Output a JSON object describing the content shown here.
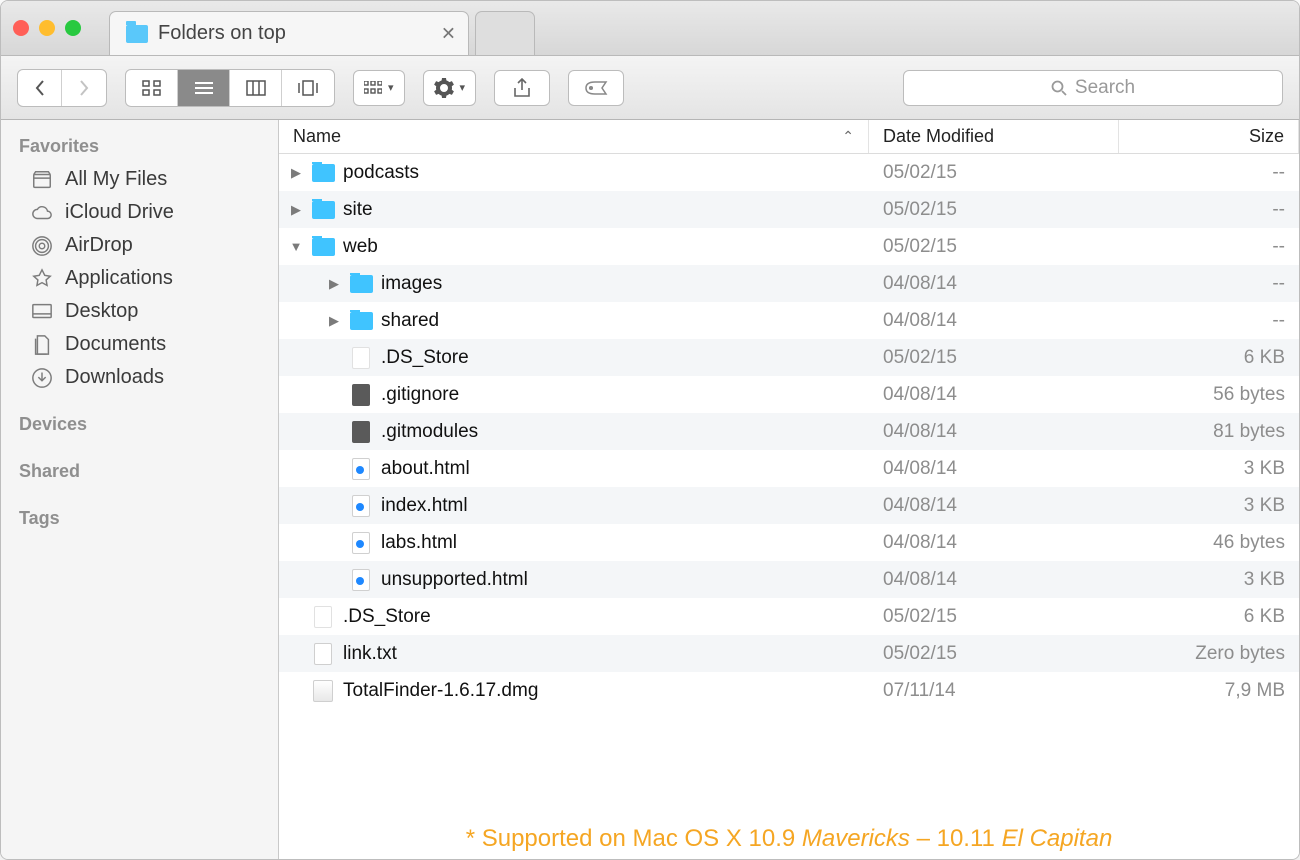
{
  "tab": {
    "title": "Folders on top"
  },
  "search": {
    "placeholder": "Search"
  },
  "sidebar": {
    "sections": [
      {
        "title": "Favorites",
        "items": [
          {
            "label": "All My Files",
            "icon": "all-my-files-icon"
          },
          {
            "label": "iCloud Drive",
            "icon": "icloud-icon"
          },
          {
            "label": "AirDrop",
            "icon": "airdrop-icon"
          },
          {
            "label": "Applications",
            "icon": "applications-icon"
          },
          {
            "label": "Desktop",
            "icon": "desktop-icon"
          },
          {
            "label": "Documents",
            "icon": "documents-icon"
          },
          {
            "label": "Downloads",
            "icon": "downloads-icon"
          }
        ]
      },
      {
        "title": "Devices",
        "items": []
      },
      {
        "title": "Shared",
        "items": []
      },
      {
        "title": "Tags",
        "items": []
      }
    ]
  },
  "columns": {
    "name": "Name",
    "date": "Date Modified",
    "size": "Size"
  },
  "rows": [
    {
      "depth": 0,
      "kind": "folder",
      "expanded": false,
      "name": "podcasts",
      "date": "05/02/15",
      "size": "--"
    },
    {
      "depth": 0,
      "kind": "folder",
      "expanded": false,
      "name": "site",
      "date": "05/02/15",
      "size": "--"
    },
    {
      "depth": 0,
      "kind": "folder",
      "expanded": true,
      "name": "web",
      "date": "05/02/15",
      "size": "--"
    },
    {
      "depth": 1,
      "kind": "folder",
      "expanded": false,
      "name": "images",
      "date": "04/08/14",
      "size": "--"
    },
    {
      "depth": 1,
      "kind": "folder",
      "expanded": false,
      "name": "shared",
      "date": "04/08/14",
      "size": "--"
    },
    {
      "depth": 1,
      "kind": "file-blank",
      "name": ".DS_Store",
      "date": "05/02/15",
      "size": "6 KB"
    },
    {
      "depth": 1,
      "kind": "file-dark",
      "name": ".gitignore",
      "date": "04/08/14",
      "size": "56 bytes"
    },
    {
      "depth": 1,
      "kind": "file-dark",
      "name": ".gitmodules",
      "date": "04/08/14",
      "size": "81 bytes"
    },
    {
      "depth": 1,
      "kind": "file-html",
      "name": "about.html",
      "date": "04/08/14",
      "size": "3 KB"
    },
    {
      "depth": 1,
      "kind": "file-html",
      "name": "index.html",
      "date": "04/08/14",
      "size": "3 KB"
    },
    {
      "depth": 1,
      "kind": "file-html",
      "name": "labs.html",
      "date": "04/08/14",
      "size": "46 bytes"
    },
    {
      "depth": 1,
      "kind": "file-html",
      "name": "unsupported.html",
      "date": "04/08/14",
      "size": "3 KB"
    },
    {
      "depth": 0,
      "kind": "file-blank",
      "name": ".DS_Store",
      "date": "05/02/15",
      "size": "6 KB"
    },
    {
      "depth": 0,
      "kind": "file-txt",
      "name": "link.txt",
      "date": "05/02/15",
      "size": "Zero bytes"
    },
    {
      "depth": 0,
      "kind": "file-dmg",
      "name": "TotalFinder-1.6.17.dmg",
      "date": "07/11/14",
      "size": "7,9 MB"
    }
  ],
  "footer": {
    "prefix": "* Supported on Mac OS X 10.9 ",
    "em1": "Mavericks",
    "mid": " – 10.11 ",
    "em2": "El Capitan"
  }
}
